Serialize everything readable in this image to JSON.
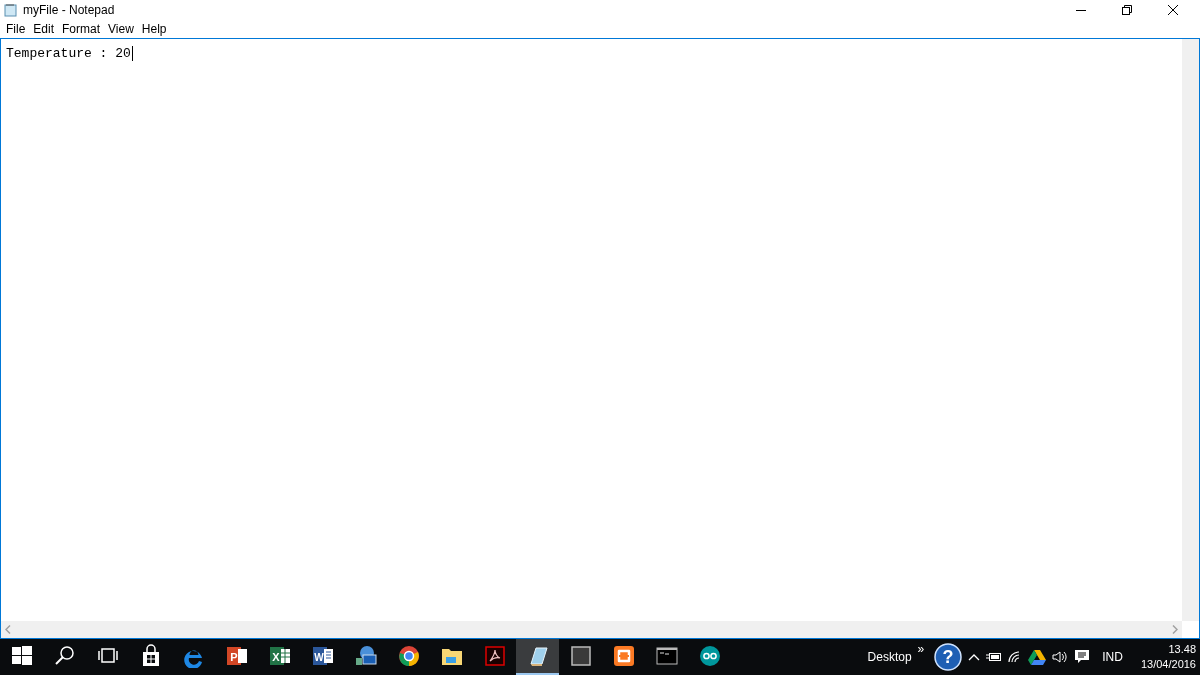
{
  "window": {
    "title": "myFile - Notepad"
  },
  "menu": [
    "File",
    "Edit",
    "Format",
    "View",
    "Help"
  ],
  "editor": {
    "text": "Temperature : 20"
  },
  "taskbar": {
    "apps": [
      {
        "kind": "start",
        "selected": false
      },
      {
        "kind": "search",
        "selected": false
      },
      {
        "kind": "taskview",
        "selected": false
      },
      {
        "kind": "store",
        "selected": false
      },
      {
        "kind": "edge",
        "selected": false
      },
      {
        "kind": "powerpoint",
        "selected": false,
        "glyph": "P"
      },
      {
        "kind": "excel",
        "selected": false,
        "glyph": "X"
      },
      {
        "kind": "word",
        "selected": false,
        "glyph": "W"
      },
      {
        "kind": "remote",
        "selected": false
      },
      {
        "kind": "chrome",
        "selected": false
      },
      {
        "kind": "folder",
        "selected": false
      },
      {
        "kind": "pdf",
        "selected": false
      },
      {
        "kind": "notepad",
        "selected": true
      },
      {
        "kind": "window",
        "selected": false
      },
      {
        "kind": "xampp",
        "selected": false
      },
      {
        "kind": "terminal",
        "selected": false
      },
      {
        "kind": "arduino",
        "selected": false
      }
    ],
    "toolbar_label": "Desktop",
    "help_glyph": "?",
    "toolbar_more": "»",
    "language": "IND",
    "time": "13.48",
    "date": "13/04/2016"
  }
}
